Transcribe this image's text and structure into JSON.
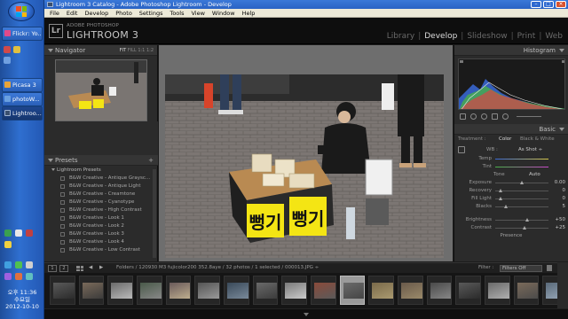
{
  "window": {
    "title": "Lightroom 3 Catalog - Adobe Photoshop Lightroom - Develop",
    "menu": [
      "File",
      "Edit",
      "Develop",
      "Photo",
      "Settings",
      "Tools",
      "View",
      "Window",
      "Help"
    ]
  },
  "taskbar": {
    "buttons": [
      {
        "label": "Flickr: Yo...",
        "color": "#e04a8a"
      },
      {
        "label": "Picasa 3",
        "color": "#e8a43a"
      },
      {
        "label": "photoW...",
        "color": "#6aa0e0"
      },
      {
        "label": "Lightroo...",
        "color": "#3a4f6e"
      }
    ],
    "clock_time": "오후 11:36",
    "clock_day": "수요일",
    "clock_date": "2012-10-10"
  },
  "header": {
    "adobe_label": "ADOBE PHOTOSHOP",
    "product_name": "LIGHTROOM 3",
    "modules": [
      "Library",
      "Develop",
      "Slideshow",
      "Print",
      "Web"
    ],
    "active_module": "Develop"
  },
  "left_panel": {
    "navigator_title": "Navigator",
    "nav_modes": [
      "FIT",
      "FILL",
      "1:1",
      "1:2"
    ],
    "presets_title": "Presets",
    "preset_folder": "Lightroom Presets",
    "presets": [
      "B&W Creative - Antique Graysc...",
      "B&W Creative - Antique Light",
      "B&W Creative - Creamtone",
      "B&W Creative - Cyanotype",
      "B&W Creative - High Contrast",
      "B&W Creative - Look 1",
      "B&W Creative - Look 2",
      "B&W Creative - Look 3",
      "B&W Creative - Look 4",
      "B&W Creative - Low Contrast"
    ]
  },
  "right_panel": {
    "histogram_title": "Histogram",
    "basic_title": "Basic",
    "treatment_label": "Treatment :",
    "treatment_color": "Color",
    "treatment_bw": "Black & White",
    "wb_label": "WB :",
    "wb_value": "As Shot ÷",
    "temp_label": "Temp",
    "tint_label": "Tint",
    "tone_label": "Tone",
    "tone_auto": "Auto",
    "sliders": [
      {
        "label": "Exposure",
        "value": "0.00",
        "level": 0.5
      },
      {
        "label": "Recovery",
        "value": "0",
        "level": 0.1
      },
      {
        "label": "Fill Light",
        "value": "0",
        "level": 0.1
      },
      {
        "label": "Blacks",
        "value": "5",
        "level": 0.2
      },
      {
        "label": "Brightness",
        "value": "+50",
        "level": 0.6
      },
      {
        "label": "Contrast",
        "value": "+25",
        "level": 0.55
      }
    ],
    "presence_label": "Presence"
  },
  "filmstrip": {
    "page1": "1",
    "page2": "2",
    "path_text": "Folders / 120930 M3 fujicolor200 352.8aye / 32 photos / 1 selected / 000013.JPG ÷",
    "filter_label": "Filter :",
    "filter_value": "Filters Off",
    "selected_index": 10,
    "thumbs": [
      {
        "c1": "#5a5a5a",
        "c2": "#2a2a2a"
      },
      {
        "c1": "#7a6a5a",
        "c2": "#3a3a3a"
      },
      {
        "c1": "#6a6a6a",
        "c2": "#bbbbbb"
      },
      {
        "c1": "#4a5a4a",
        "c2": "#888888"
      },
      {
        "c1": "#6a5a5a",
        "c2": "#c0b090"
      },
      {
        "c1": "#555555",
        "c2": "#9a9a9a"
      },
      {
        "c1": "#3a4a5a",
        "c2": "#7a8a9a"
      },
      {
        "c1": "#6a6a6a",
        "c2": "#3a3a3a"
      },
      {
        "c1": "#7a7a7a",
        "c2": "#cccccc"
      },
      {
        "c1": "#8a4a3a",
        "c2": "#5a5a5a"
      },
      {
        "c1": "#6a6a6a",
        "c2": "#444444"
      },
      {
        "c1": "#7a6a4a",
        "c2": "#aa9a70"
      },
      {
        "c1": "#6a5a4a",
        "c2": "#9a8a6a"
      },
      {
        "c1": "#4a4a4a",
        "c2": "#888888"
      },
      {
        "c1": "#5a5a5a",
        "c2": "#2a2a2a"
      },
      {
        "c1": "#6a6a6a",
        "c2": "#b0b0b0"
      },
      {
        "c1": "#7a6a5a",
        "c2": "#4a4a4a"
      },
      {
        "c1": "#5a6a7a",
        "c2": "#9aaabb"
      }
    ]
  },
  "colors": {
    "sign_yellow": "#f4e514",
    "stall_wood": "#b98a52",
    "vendor_black": "#1a1a1a"
  },
  "photo": {
    "sign_text_left": "뻥기",
    "sign_text_right": "뻥기"
  }
}
